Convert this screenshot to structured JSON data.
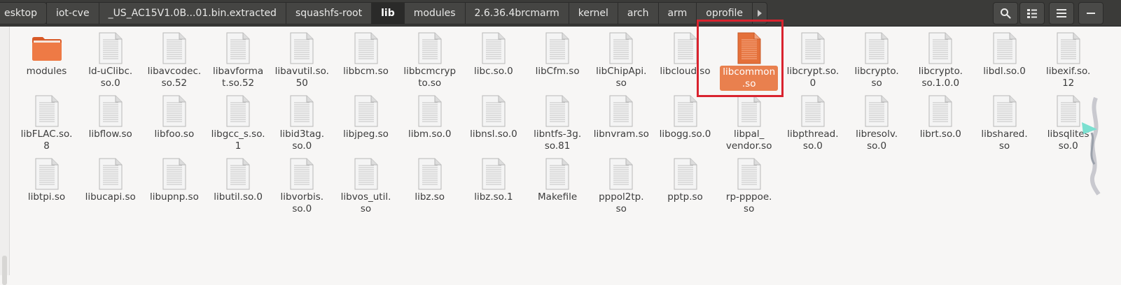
{
  "breadcrumbs": [
    "esktop",
    "iot-cve",
    "_US_AC15V1.0B...01.bin.extracted",
    "squashfs-root",
    "lib",
    "modules",
    "2.6.36.4brcmarm",
    "kernel",
    "arch",
    "arm",
    "oprofile"
  ],
  "active_crumb": "lib",
  "toolbar": {
    "search_icon": "search-icon",
    "view_icon": "list-view-icon",
    "menu_icon": "hamburger-menu-icon",
    "window_icon": "minimize-icon"
  },
  "selected_file": "libcommon.so",
  "colors": {
    "accent": "#e9804e",
    "highlight": "#d9232e",
    "folder": "#e8703c"
  },
  "files": [
    {
      "name": "modules",
      "label": "modules",
      "type": "folder"
    },
    {
      "name": "ld-uClibc.so.0",
      "label": "ld-uClibc.\nso.0",
      "type": "file"
    },
    {
      "name": "libavcodec.so.52",
      "label": "libavcodec.\nso.52",
      "type": "file"
    },
    {
      "name": "libavformat.so.52",
      "label": "libavforma\nt.so.52",
      "type": "file"
    },
    {
      "name": "libavutil.so.50",
      "label": "libavutil.so.\n50",
      "type": "file"
    },
    {
      "name": "libbcm.so",
      "label": "libbcm.so",
      "type": "file"
    },
    {
      "name": "libbcmcrypto.so",
      "label": "libbcmcryp\nto.so",
      "type": "file"
    },
    {
      "name": "libc.so.0",
      "label": "libc.so.0",
      "type": "file"
    },
    {
      "name": "libCfm.so",
      "label": "libCfm.so",
      "type": "file"
    },
    {
      "name": "libChipApi.so",
      "label": "libChipApi.\nso",
      "type": "file"
    },
    {
      "name": "libcloud.so",
      "label": "libcloud.so",
      "type": "file"
    },
    {
      "name": "libcommon.so",
      "label": "libcommon\n.so",
      "type": "file"
    },
    {
      "name": "libcrypt.so.0",
      "label": "libcrypt.so.\n0",
      "type": "file"
    },
    {
      "name": "libcrypto.so",
      "label": "libcrypto.\nso",
      "type": "file"
    },
    {
      "name": "libcrypto.so.1.0.0",
      "label": "libcrypto.\nso.1.0.0",
      "type": "file"
    },
    {
      "name": "libdl.so.0",
      "label": "libdl.so.0",
      "type": "file"
    },
    {
      "name": "libexif.so.12",
      "label": "libexif.so.\n12",
      "type": "file"
    },
    {
      "name": "libFLAC.so.8",
      "label": "libFLAC.so.\n8",
      "type": "file"
    },
    {
      "name": "libflow.so",
      "label": "libflow.so",
      "type": "file"
    },
    {
      "name": "libfoo.so",
      "label": "libfoo.so",
      "type": "file"
    },
    {
      "name": "libgcc_s.so.1",
      "label": "libgcc_s.so.\n1",
      "type": "file"
    },
    {
      "name": "libid3tag.so.0",
      "label": "libid3tag.\nso.0",
      "type": "file"
    },
    {
      "name": "libjpeg.so",
      "label": "libjpeg.so",
      "type": "file"
    },
    {
      "name": "libm.so.0",
      "label": "libm.so.0",
      "type": "file"
    },
    {
      "name": "libnsl.so.0",
      "label": "libnsl.so.0",
      "type": "file"
    },
    {
      "name": "libntfs-3g.so.81",
      "label": "libntfs-3g.\nso.81",
      "type": "file"
    },
    {
      "name": "libnvram.so",
      "label": "libnvram.so",
      "type": "file"
    },
    {
      "name": "libogg.so.0",
      "label": "libogg.so.0",
      "type": "file"
    },
    {
      "name": "libpal_vendor.so",
      "label": "libpal_\nvendor.so",
      "type": "file"
    },
    {
      "name": "libpthread.so.0",
      "label": "libpthread.\nso.0",
      "type": "file"
    },
    {
      "name": "libresolv.so.0",
      "label": "libresolv.\nso.0",
      "type": "file"
    },
    {
      "name": "librt.so.0",
      "label": "librt.so.0",
      "type": "file"
    },
    {
      "name": "libshared.so",
      "label": "libshared.\nso",
      "type": "file"
    },
    {
      "name": "libsqlite3.so.0",
      "label": "libsqlites\nso.0",
      "type": "file"
    },
    {
      "name": "libtpi.so",
      "label": "libtpi.so",
      "type": "file"
    },
    {
      "name": "libucapi.so",
      "label": "libucapi.so",
      "type": "file"
    },
    {
      "name": "libupnp.so",
      "label": "libupnp.so",
      "type": "file"
    },
    {
      "name": "libutil.so.0",
      "label": "libutil.so.0",
      "type": "file"
    },
    {
      "name": "libvorbis.so.0",
      "label": "libvorbis.\nso.0",
      "type": "file"
    },
    {
      "name": "libvos_util.so",
      "label": "libvos_util.\nso",
      "type": "file"
    },
    {
      "name": "libz.so",
      "label": "libz.so",
      "type": "file"
    },
    {
      "name": "libz.so.1",
      "label": "libz.so.1",
      "type": "file"
    },
    {
      "name": "Makefile",
      "label": "Makefile",
      "type": "file"
    },
    {
      "name": "pppol2tp.so",
      "label": "pppol2tp.\nso",
      "type": "file"
    },
    {
      "name": "pptp.so",
      "label": "pptp.so",
      "type": "file"
    },
    {
      "name": "rp-pppoe.so",
      "label": "rp-pppoe.\nso",
      "type": "file"
    }
  ]
}
